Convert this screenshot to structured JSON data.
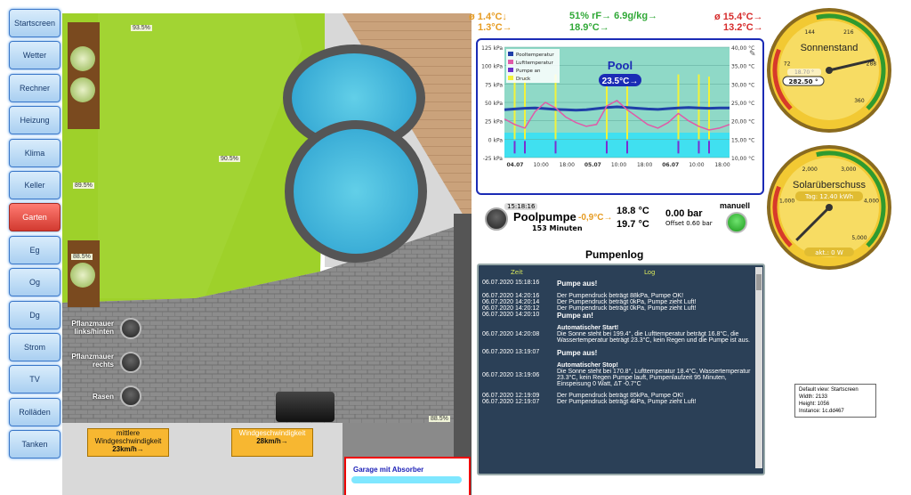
{
  "sidebar": {
    "items": [
      {
        "label": "Startscreen",
        "active": false
      },
      {
        "label": "Wetter",
        "active": false
      },
      {
        "label": "Rechner",
        "active": false
      },
      {
        "label": "Heizung",
        "active": false
      },
      {
        "label": "Klima",
        "active": false
      },
      {
        "label": "Keller",
        "active": false
      },
      {
        "label": "Garten",
        "active": true
      },
      {
        "label": "Eg",
        "active": false
      },
      {
        "label": "Og",
        "active": false
      },
      {
        "label": "Dg",
        "active": false
      },
      {
        "label": "Strom",
        "active": false
      },
      {
        "label": "TV",
        "active": false
      },
      {
        "label": "Rolläden",
        "active": false
      },
      {
        "label": "Tanken",
        "active": false
      }
    ]
  },
  "garden": {
    "pct_top": "93.5%",
    "pct_lawn": "90.5%",
    "pct_left": "89.5%",
    "pct_bottom": "88.5%",
    "pct_shrub3": "88.5%",
    "valves": [
      {
        "label": "Pflanzmauer links/hinten"
      },
      {
        "label": "Pflanzmauer rechts"
      },
      {
        "label": "Rasen"
      }
    ],
    "wind_avg": {
      "title": "mittlere Windgeschwindigkeit",
      "value": "23km/h→"
    },
    "wind_cur": {
      "title": "Windgeschwindigkeit",
      "value": "28km/h→"
    },
    "garage_label": "Garage mit Absorber"
  },
  "weather": {
    "left_avg": "ø 1.4°C↓",
    "left_cur": "1.3°C→",
    "mid_humidity": "51% rF→ 6.9g/kg→",
    "mid_temp": "18.9°C→",
    "right_avg": "ø 15.4°C→",
    "right_cur": "13.2°C→",
    "colors": {
      "orange": "#e69b21",
      "green": "#2fa836",
      "red": "#d62b2b"
    }
  },
  "chart_data": {
    "type": "line",
    "title": "Pool",
    "badge": "23.5°C→",
    "legend": [
      "Pooltemperatur",
      "Lufttemperatur",
      "Pumpe an",
      "Druck"
    ],
    "legend_colors": [
      "#1f3fa8",
      "#e05aa8",
      "#6a2fc9",
      "#f2f23a"
    ],
    "left_axis": {
      "ticks": [
        "125 kPa",
        "100 kPa",
        "75 kPa",
        "50 kPa",
        "25 kPa",
        "0 kPa",
        "-25 kPa"
      ],
      "ylim": [
        -25,
        125
      ]
    },
    "right_axis": {
      "ticks": [
        "40,00 °C",
        "35,00 °C",
        "30,00 °C",
        "25,00 °C",
        "20,00 °C",
        "15,00 °C",
        "10,00 °C"
      ],
      "ylim": [
        10,
        40
      ]
    },
    "x_ticks": [
      "04.07",
      "10:00",
      "18:00",
      "05.07",
      "10:00",
      "18:00",
      "06.07",
      "10:00",
      "18:00"
    ],
    "series": [
      {
        "name": "Pooltemperatur",
        "values": [
          23.0,
          23.2,
          23.4,
          23.5,
          23.3,
          23.1,
          23.0,
          22.9,
          23.0,
          23.3,
          23.6,
          23.8,
          23.6,
          23.4,
          23.2,
          23.1,
          23.3,
          23.5,
          23.6,
          23.5,
          23.4,
          23.5,
          23.5
        ]
      },
      {
        "name": "Lufttemperatur",
        "values": [
          20.5,
          19.0,
          18.0,
          22.5,
          25.0,
          23.5,
          21.0,
          19.5,
          18.5,
          19.0,
          24.0,
          25.5,
          23.0,
          21.0,
          19.0,
          18.0,
          19.5,
          22.0,
          20.0,
          18.5,
          17.5,
          18.0,
          19.0
        ]
      },
      {
        "name": "Druck",
        "values": [
          4,
          88,
          85,
          4,
          4,
          88,
          4,
          4,
          4,
          4,
          88,
          4,
          85,
          4,
          4,
          4,
          4,
          88,
          4,
          88,
          85,
          4,
          4
        ]
      }
    ]
  },
  "pump": {
    "time": "15:18:16",
    "title": "Poolpumpe",
    "delta": "-0,9°C→",
    "minutes": "153 Minuten",
    "temp1": "18.8 °C",
    "temp2": "19.7 °C",
    "pressure": "0.00 bar",
    "offset": "Offset 0.60 bar",
    "mode": "manuell"
  },
  "pumplog": {
    "title": "Pumpenlog",
    "col_time": "Zeit",
    "col_log": "Log",
    "entries": [
      {
        "time": "06.07.2020 15:18:16",
        "msg": "Pumpe aus!",
        "bold": true
      },
      {
        "time": "06.07.2020 14:20:16",
        "msg": "Der Pumpendruck beträgt 88kPa, Pumpe OK!",
        "bold": false
      },
      {
        "time": "06.07.2020 14:20:14",
        "msg": "Der Pumpendruck beträgt 0kPa, Pumpe zieht Luft!",
        "bold": false
      },
      {
        "time": "06.07.2020 14:20:12",
        "msg": "Der Pumpendruck beträgt 0kPa, Pumpe zieht Luft!",
        "bold": false
      },
      {
        "time": "06.07.2020 14:20:10",
        "msg": "Pumpe an!",
        "bold": true
      },
      {
        "time": "06.07.2020 14:20:08",
        "msg": "Automatischer Start!",
        "bold": true,
        "detail": "Die Sonne steht bei 199.4°, die Lufttemperatur beträgt 16.8°C, die Wassertemperatur beträgt 23.3°C, kein Regen und die Pumpe ist aus."
      },
      {
        "time": "06.07.2020 13:19:07",
        "msg": "Pumpe aus!",
        "bold": true
      },
      {
        "time": "06.07.2020 13:19:06",
        "msg": "Automatischer Stop!",
        "bold": true,
        "detail": "Die Sonne steht bei 170.8°, Lufttemperatur 18.4°C, Wassertemperatur 23.3°C, kein Regen Pumpe lauft, Pumpenlaufzeit 95 Minuten, Einspeisung 0 Watt, ΔT -0.7°C"
      },
      {
        "time": "06.07.2020 12:19:09",
        "msg": "Der Pumpendruck beträgt 85kPa, Pumpe OK!",
        "bold": false
      },
      {
        "time": "06.07.2020 12:19:07",
        "msg": "Der Pumpendruck beträgt 4kPa, Pumpe zieht Luft!",
        "bold": false
      }
    ]
  },
  "gauge_sun": {
    "title": "Sonnenstand",
    "ticks": [
      "72",
      "144",
      "216",
      "288",
      "360"
    ],
    "value_small": "18.70 °",
    "value_main": "282.50 °",
    "value": 282.5,
    "max": 360
  },
  "gauge_solar": {
    "title": "Solarüberschuss",
    "subtitle": "Tag: 12.40 kWh",
    "ticks": [
      "1,000",
      "2,000",
      "3,000",
      "4,000",
      "5,000"
    ],
    "value_text": "akt.: 0 W",
    "value": 0,
    "max": 5000
  },
  "info": {
    "line1": "Default view: Startscreen",
    "line2": "Width: 2133",
    "line3": "Height: 1056",
    "line4": "Instance: 1c.dd467"
  }
}
